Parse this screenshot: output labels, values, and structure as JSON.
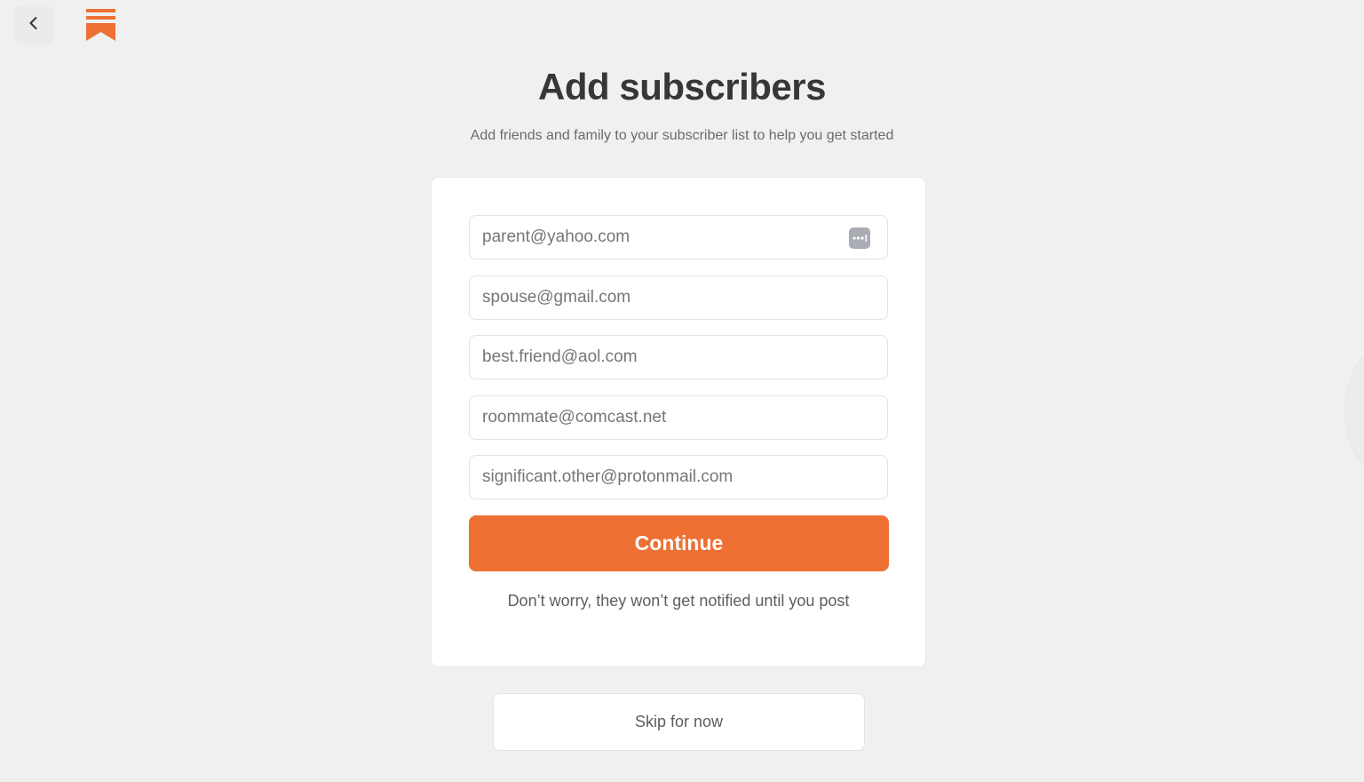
{
  "header": {
    "back_icon": "chevron-left-icon",
    "logo_icon": "bookmark-stack-logo",
    "logo_color": "#ee7033"
  },
  "main": {
    "title": "Add subscribers",
    "subtitle": "Add friends and family to your subscriber list to help you get started"
  },
  "form": {
    "fields": [
      {
        "placeholder": "parent@yahoo.com",
        "value": ""
      },
      {
        "placeholder": "spouse@gmail.com",
        "value": ""
      },
      {
        "placeholder": "best.friend@aol.com",
        "value": ""
      },
      {
        "placeholder": "roommate@comcast.net",
        "value": ""
      },
      {
        "placeholder": "significant.other@protonmail.com",
        "value": ""
      }
    ],
    "password_manager_icon": "password-manager-icon",
    "continue_label": "Continue",
    "note": "Don’t worry, they won’t get notified until you post"
  },
  "footer": {
    "skip_label": "Skip for now"
  },
  "colors": {
    "accent": "#ee7033",
    "background": "#f0f0f0",
    "card": "#ffffff"
  }
}
